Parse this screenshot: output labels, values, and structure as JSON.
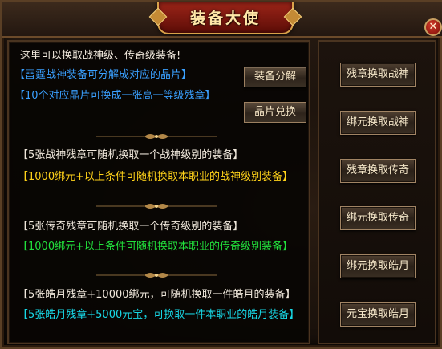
{
  "window": {
    "title": "装备大使",
    "close_icon": "close-icon"
  },
  "intro": {
    "line1": "这里可以换取战神级、传奇级装备!",
    "line2": "【雷霆战神装备可分解成对应的晶片】",
    "line3": "【10个对应晶片可换成一张高一等级残章】"
  },
  "buttons": {
    "decompose": "装备分解",
    "chip_exchange": "晶片兑换"
  },
  "sections": [
    {
      "heading": "【5张战神残章可随机换取一个战神级别的装备】",
      "condition": "【1000绑元+以上条件可随机换取本职业的战神级别装备】"
    },
    {
      "heading": "【5张传奇残章可随机换取一个传奇级别的装备】",
      "condition": "【1000绑元+以上条件可随机换取本职业的传奇级别装备】"
    },
    {
      "heading": "【5张皓月残章+10000绑元，可随机换取一件皓月的装备】",
      "condition": "【5张皓月残章+5000元宝，可换取一件本职业的皓月装备】"
    }
  ],
  "side_buttons": [
    "残章换取战神",
    "绑元换取战神",
    "残章换取传奇",
    "绑元换取传奇",
    "绑元换取皓月",
    "元宝换取皓月"
  ],
  "colors": {
    "blue": "#3aa0ff",
    "yellow": "#ffd21a",
    "green": "#22e03c",
    "cyan": "#18d8e6",
    "title_gold": "#ffe7a8"
  }
}
